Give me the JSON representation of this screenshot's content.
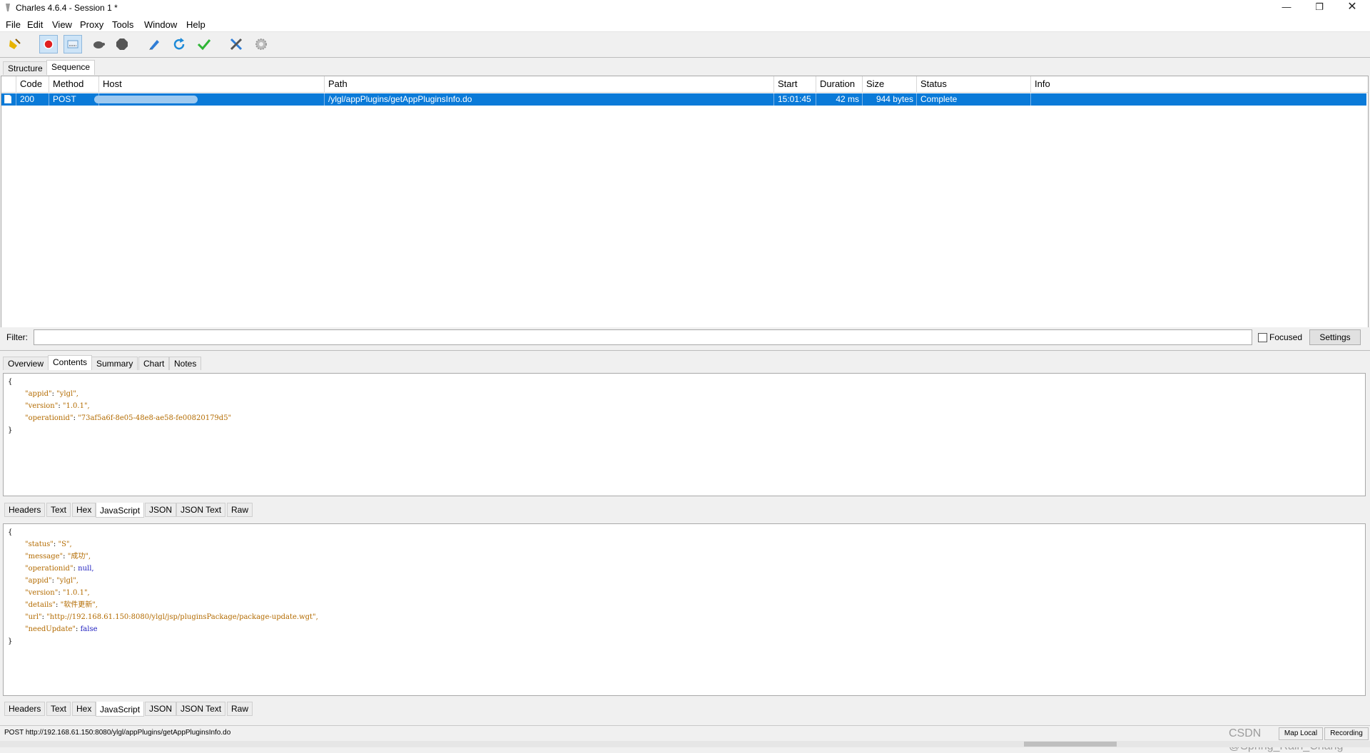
{
  "window": {
    "title": "Charles 4.6.4 - Session 1 *",
    "minimize": "—",
    "restore": "❐",
    "close": "✕"
  },
  "menu": [
    "File",
    "Edit",
    "View",
    "Proxy",
    "Tools",
    "Window",
    "Help"
  ],
  "toolbar": {
    "icons": [
      "broom-icon",
      "record-icon",
      "throttle-icon",
      "turtle-icon",
      "breakpoint-icon",
      "compose-icon",
      "repeat-icon",
      "validate-icon",
      "tools-icon",
      "settings-gear-icon"
    ]
  },
  "top_tabs": [
    "Structure",
    "Sequence"
  ],
  "table": {
    "headers": [
      "Code",
      "Method",
      "Host",
      "Path",
      "Start",
      "Duration",
      "Size",
      "Status",
      "Info"
    ],
    "rows": [
      {
        "code": "200",
        "method": "POST",
        "host": "",
        "path": "/ylgl/appPlugins/getAppPluginsInfo.do",
        "start": "15:01:45",
        "duration": "42 ms",
        "size": "944 bytes",
        "status": "Complete",
        "info": ""
      }
    ]
  },
  "filter": {
    "label": "Filter:",
    "value": "",
    "focused_label": "Focused",
    "settings": "Settings"
  },
  "detail_tabs": [
    "Overview",
    "Contents",
    "Summary",
    "Chart",
    "Notes"
  ],
  "request_view_tabs": [
    "Headers",
    "Text",
    "Hex",
    "JavaScript",
    "JSON",
    "JSON Text",
    "Raw"
  ],
  "response_view_tabs": [
    "Headers",
    "Text",
    "Hex",
    "JavaScript",
    "JSON",
    "JSON Text",
    "Raw"
  ],
  "request_body": {
    "open": "{",
    "lines": [
      {
        "key": "\"appid\"",
        "value": "\"ylgl\",",
        "type": "s"
      },
      {
        "key": "\"version\"",
        "value": "\"1.0.1\",",
        "type": "s"
      },
      {
        "key": "\"operationid\"",
        "value": "\"73af5a6f-8e05-48e8-ae58-fe00820179d5\"",
        "type": "s"
      }
    ],
    "close": "}"
  },
  "response_body": {
    "open": "{",
    "lines": [
      {
        "key": "\"status\"",
        "value": "\"S\",",
        "type": "s"
      },
      {
        "key": "\"message\"",
        "value": "\"成功\",",
        "type": "s"
      },
      {
        "key": "\"operationid\"",
        "value": "null,",
        "type": "kw"
      },
      {
        "key": "\"appid\"",
        "value": "\"ylgl\",",
        "type": "s"
      },
      {
        "key": "\"version\"",
        "value": "\"1.0.1\",",
        "type": "s"
      },
      {
        "key": "\"details\"",
        "value": "\"软件更新\",",
        "type": "s"
      },
      {
        "key": "\"url\"",
        "value": "\"http://192.168.61.150:8080/ylgl/jsp/pluginsPackage/package-update.wgt\",",
        "type": "s"
      },
      {
        "key": "\"needUpdate\"",
        "value": "false",
        "type": "kw"
      }
    ],
    "close": "}"
  },
  "statusbar": {
    "text": "POST http://192.168.61.150:8080/ylgl/appPlugins/getAppPluginsInfo.do",
    "button1": "Map Local",
    "button2": "Recording"
  },
  "watermark": "CSDN @Spring_Rain_Chang",
  "colors": {
    "selection": "#0a7ad8",
    "json_key": "#b36b00",
    "json_keyword": "#2020c0"
  }
}
